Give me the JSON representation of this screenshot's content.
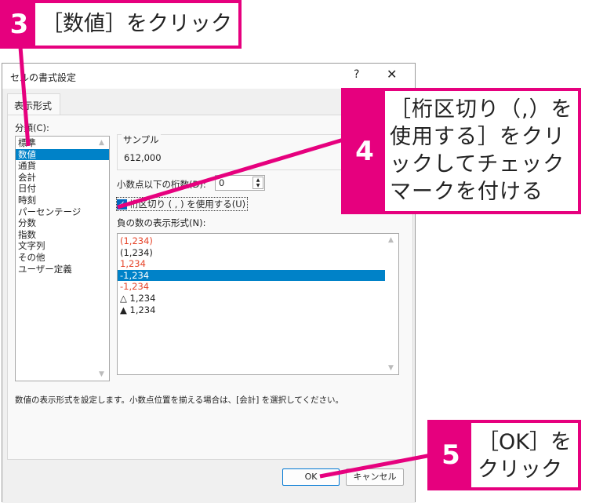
{
  "dialog": {
    "title": "セルの書式設定",
    "help": "?",
    "close": "✕",
    "tab": "表示形式",
    "category_label": "分類(C):",
    "categories": [
      "標準",
      "数値",
      "通貨",
      "会計",
      "日付",
      "時刻",
      "パーセンテージ",
      "分数",
      "指数",
      "文字列",
      "その他",
      "ユーザー定義"
    ],
    "selected_category": "数値",
    "sample_label": "サンプル",
    "sample_value": "612,000",
    "decimal_label": "小数点以下の桁数(D):",
    "decimal_value": "0",
    "separator_label": "桁区切り ( , ) を使用する(U)",
    "separator_checked": true,
    "negative_label": "負の数の表示形式(N):",
    "negative_formats": [
      {
        "text": "(1,234)",
        "red": true
      },
      {
        "text": "(1,234)",
        "red": false
      },
      {
        "text": "1,234",
        "red": true
      },
      {
        "text": "-1,234",
        "red": false,
        "selected": true
      },
      {
        "text": "-1,234",
        "red": true
      },
      {
        "text": "△ 1,234",
        "red": false
      },
      {
        "text": "▲ 1,234",
        "red": false
      }
    ],
    "description": "数値の表示形式を設定します。小数点位置を揃える場合は、[会計] を選択してください。",
    "ok": "OK",
    "cancel": "キャンセル"
  },
  "callouts": [
    {
      "number": "3",
      "text": "［数値］をクリック"
    },
    {
      "number": "4",
      "text": "［桁区切り（,）を使用する］をクリックしてチェックマークを付ける"
    },
    {
      "number": "5",
      "text": "［OK］をクリック"
    }
  ],
  "colors": {
    "accent": "#e6007e",
    "selection": "#0082c8",
    "negative_red": "#e6452a"
  }
}
